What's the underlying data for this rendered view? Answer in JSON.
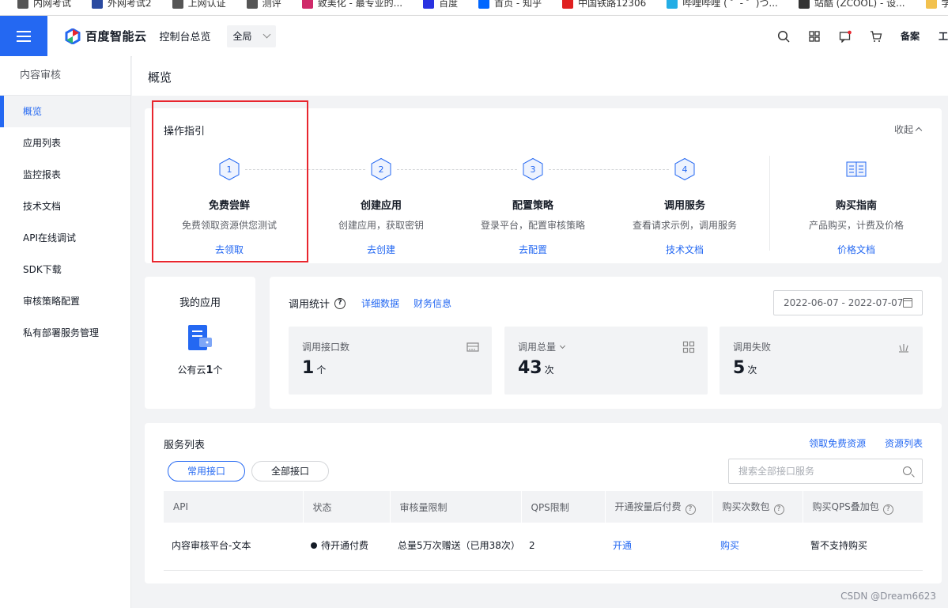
{
  "bookmarks": [
    {
      "label": "内网考试",
      "color": "#555555"
    },
    {
      "label": "外网考试2",
      "color": "#2a4aa0"
    },
    {
      "label": "上网认证",
      "color": "#555555"
    },
    {
      "label": "测评",
      "color": "#555555"
    },
    {
      "label": "致美化 - 最专业的...",
      "color": "#d02a6a"
    },
    {
      "label": "百度",
      "color": "#2932e1"
    },
    {
      "label": "首页 - 知乎",
      "color": "#0066ff"
    },
    {
      "label": "中国铁路12306",
      "color": "#e02020"
    },
    {
      "label": "哔哩哔哩 ( ゜- ゜)つ...",
      "color": "#23ade5"
    },
    {
      "label": "站酷 (ZCOOL) - 设...",
      "color": "#333333"
    },
    {
      "label": "学习",
      "color": "#f2c14e"
    }
  ],
  "header": {
    "logo_text": "百度智能云",
    "console_link": "控制台总览",
    "region": "全局",
    "beian": "备案",
    "cut_text": "工"
  },
  "sidebar": {
    "title": "内容审核",
    "items": [
      "概览",
      "应用列表",
      "监控报表",
      "技术文档",
      "API在线调试",
      "SDK下载",
      "审核策略配置",
      "私有部署服务管理"
    ]
  },
  "page": {
    "title": "概览"
  },
  "guide": {
    "title": "操作指引",
    "collapse": "收起",
    "steps": [
      {
        "num": "1",
        "name": "免费尝鲜",
        "desc": "免费领取资源供您测试",
        "link": "去领取"
      },
      {
        "num": "2",
        "name": "创建应用",
        "desc": "创建应用，获取密钥",
        "link": "去创建"
      },
      {
        "num": "3",
        "name": "配置策略",
        "desc": "登录平台，配置审核策略",
        "link": "去配置"
      },
      {
        "num": "4",
        "name": "调用服务",
        "desc": "查看请求示例，调用服务",
        "link": "技术文档"
      }
    ],
    "purchase": {
      "name": "购买指南",
      "desc": "产品购买，计费及价格",
      "link": "价格文档"
    }
  },
  "myapp": {
    "title": "我的应用",
    "prefix": "公有云",
    "count": "1",
    "unit": "个"
  },
  "stats": {
    "title": "调用统计",
    "link_detail": "详细数据",
    "link_finance": "财务信息",
    "date_range": "2022-06-07 - 2022-07-07",
    "boxes": [
      {
        "label": "调用接口数",
        "value": "1",
        "unit": "个"
      },
      {
        "label": "调用总量",
        "value": "43",
        "unit": "次"
      },
      {
        "label": "调用失败",
        "value": "5",
        "unit": "次"
      }
    ]
  },
  "services": {
    "title": "服务列表",
    "link_free": "领取免费资源",
    "link_resources": "资源列表",
    "tab_common": "常用接口",
    "tab_all": "全部接口",
    "search_placeholder": "搜索全部接口服务",
    "columns": [
      "API",
      "状态",
      "审核量限制",
      "QPS限制",
      "开通按量后付费",
      "购买次数包",
      "购买QPS叠加包"
    ],
    "rows": [
      {
        "api": "内容审核平台-文本",
        "status": "待开通付费",
        "limit": "总量5万次赠送（已用38次）",
        "qps": "2",
        "enable": "开通",
        "buy": "购买",
        "qps_pack": "暂不支持购买"
      }
    ]
  },
  "watermark": "CSDN @Dream6623",
  "colors": {
    "primary": "#2468f2",
    "highlight": "#e8262e"
  }
}
